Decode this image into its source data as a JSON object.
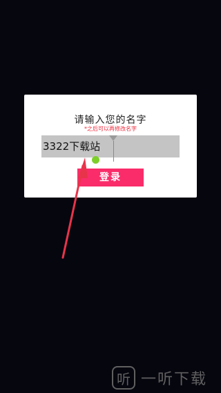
{
  "dialog": {
    "title": "请输入您的名字",
    "hint": "*之后可以再修改名字",
    "name_input": {
      "value": "3322下载站"
    },
    "login_button_label": "登录"
  },
  "watermark": {
    "logo_glyph": "听",
    "text": "一听下载"
  },
  "colors": {
    "background": "#06060f",
    "accent_button": "#fa2c6a",
    "hint": "#ee2a3c",
    "annotation_arrow": "#e8344a",
    "cursor_handle": "#7ecf2c"
  }
}
